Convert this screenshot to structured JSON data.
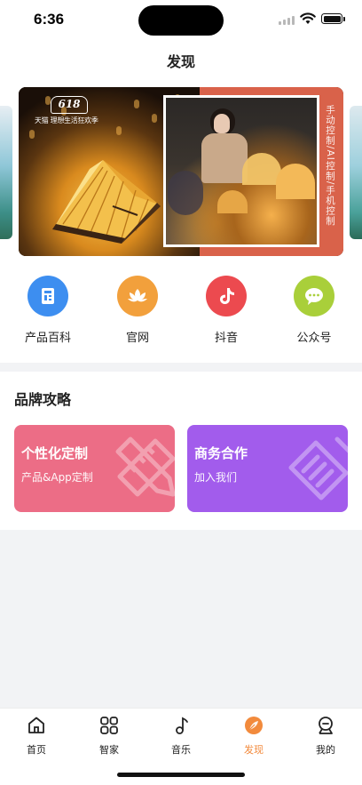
{
  "status_bar": {
    "time": "6:36"
  },
  "page_title": "发现",
  "banner": {
    "logo_number": "618",
    "logo_text": "天猫 理想生活狂欢季",
    "vertical_text": "手动控制/AI控制/手机控制"
  },
  "shortcuts": [
    {
      "label": "产品百科",
      "icon": "book-icon",
      "color": "#3d8ef0"
    },
    {
      "label": "官网",
      "icon": "lotus-icon",
      "color": "#f2a03c"
    },
    {
      "label": "抖音",
      "icon": "tiktok-icon",
      "color": "#ec4a4f"
    },
    {
      "label": "公众号",
      "icon": "wechat-icon",
      "color": "#a9cf3a"
    }
  ],
  "brand": {
    "title": "品牌攻略",
    "cards": [
      {
        "title": "个性化定制",
        "subtitle": "产品&App定制",
        "color": "#ec6d86"
      },
      {
        "title": "商务合作",
        "subtitle": "加入我们",
        "color": "#a25cec"
      }
    ]
  },
  "tab_bar": {
    "active_index": 3,
    "active_color": "#f28a3c",
    "tabs": [
      {
        "label": "首页",
        "icon": "home-icon"
      },
      {
        "label": "智家",
        "icon": "grid-icon"
      },
      {
        "label": "音乐",
        "icon": "music-note-icon"
      },
      {
        "label": "发现",
        "icon": "discover-icon"
      },
      {
        "label": "我的",
        "icon": "profile-icon"
      }
    ]
  }
}
